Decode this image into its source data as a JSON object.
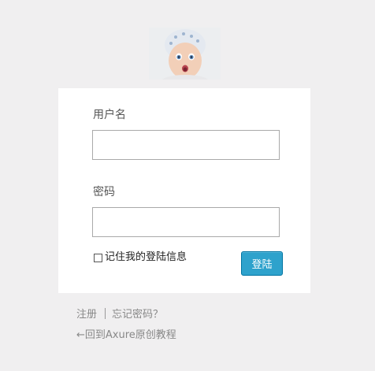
{
  "logo": {
    "icon": "baby-photo-logo"
  },
  "form": {
    "username_label": "用户名",
    "username_value": "",
    "password_label": "密码",
    "password_value": "",
    "remember_label": "记住我的登陆信息",
    "remember_checked": false,
    "login_button": "登陆"
  },
  "links": {
    "register": "注册",
    "forgot_password": "忘记密码？",
    "back": "←回到Axure原创教程"
  },
  "colors": {
    "background": "#f0eff0",
    "card": "#ffffff",
    "button": "#2ea2cc",
    "link": "#888888"
  }
}
